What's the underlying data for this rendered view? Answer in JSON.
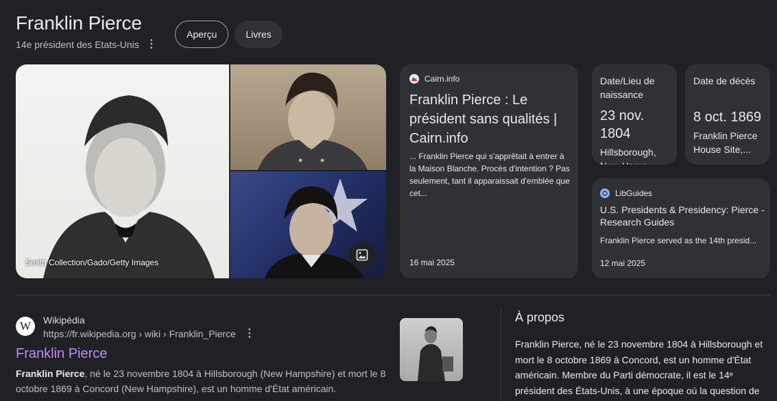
{
  "header": {
    "title": "Franklin Pierce",
    "subtitle": "14e président des Etats-Unis"
  },
  "tabs": [
    {
      "label": "Aperçu",
      "active": true
    },
    {
      "label": "Livres",
      "active": false
    }
  ],
  "media": {
    "credit": "Smith Collection/Gado/Getty Images"
  },
  "cairn_card": {
    "source": "Cairn.info",
    "title": "Franklin Pierce : Le président sans qualités | Cairn.info",
    "snippet": "... Franklin Pierce qui s'apprêtait à entrer à la Maison Blanche. Procès d'intention ? Pas seulement, tant il apparaissait d'emblée que cet...",
    "date": "16 mai 2025"
  },
  "birth_card": {
    "label": "Date/Lieu de naissance",
    "value": "23 nov. 1804",
    "place": "Hillsborough, New Hamp..."
  },
  "death_card": {
    "label": "Date de décès",
    "value": "8 oct. 1869",
    "place": "Franklin Pierce House Site,..."
  },
  "libguides_card": {
    "source": "LibGuides",
    "title": "U.S. Presidents & Presidency: Pierce - Research Guides",
    "snippet": "Franklin Pierce served as the 14th presid...",
    "date": "12 mai 2025"
  },
  "wiki_result": {
    "icon_letter": "W",
    "site": "Wikipédia",
    "url": "https://fr.wikipedia.org › wiki › Franklin_Pierce",
    "link": "Franklin Pierce",
    "snippet_bold": "Franklin Pierce",
    "snippet_rest": ", né le 23 novembre 1804 à Hillsborough (New Hampshire) et mort le 8 octobre 1869 à Concord (New Hampshire), est un homme d'État américain."
  },
  "about": {
    "heading": "À propos",
    "text": "Franklin Pierce, né le 23 novembre 1804 à Hillsborough et mort le 8 octobre 1869 à Concord, est un homme d'État américain. Membre du Parti démocrate, il est le 14ᵉ président des États-Unis, à une époque où la question de"
  },
  "icons": {
    "more": "kebab-icon",
    "image_search": "image-icon",
    "wiki": "wikipedia-icon"
  },
  "colors": {
    "background": "#202124",
    "card": "#303134",
    "link_visited": "#c58af9"
  }
}
